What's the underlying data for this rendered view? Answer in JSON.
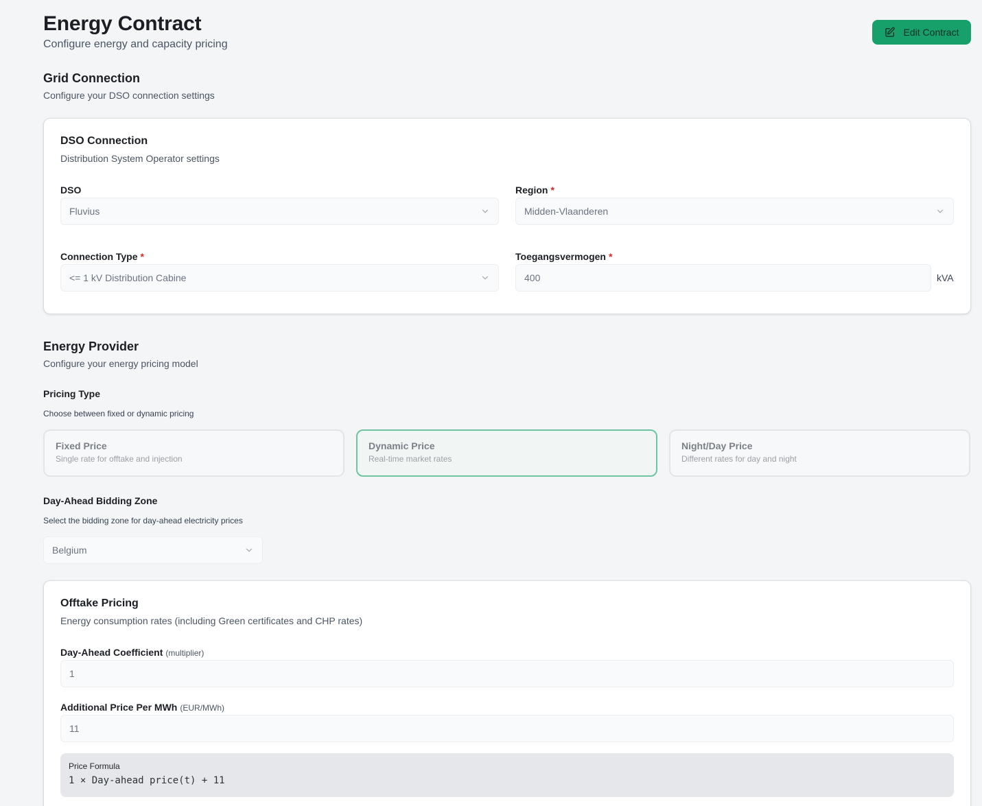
{
  "header": {
    "title": "Energy Contract",
    "subtitle": "Configure energy and capacity pricing",
    "edit_button": "Edit Contract"
  },
  "grid_connection": {
    "title": "Grid Connection",
    "subtitle": "Configure your DSO connection settings",
    "card": {
      "title": "DSO Connection",
      "subtitle": "Distribution System Operator settings",
      "dso": {
        "label": "DSO",
        "value": "Fluvius"
      },
      "region": {
        "label": "Region",
        "value": "Midden-Vlaanderen",
        "required": "*"
      },
      "connection_type": {
        "label": "Connection Type",
        "value": "<= 1 kV Distribution Cabine",
        "required": "*"
      },
      "access_power": {
        "label": "Toegangsvermogen",
        "value": "400",
        "unit": "kVA",
        "required": "*"
      }
    }
  },
  "energy_provider": {
    "title": "Energy Provider",
    "subtitle": "Configure your energy pricing model",
    "pricing_type": {
      "label": "Pricing Type",
      "description": "Choose between fixed or dynamic pricing",
      "selected": "Dynamic Price",
      "options": [
        {
          "title": "Fixed Price",
          "description": "Single rate for offtake and injection"
        },
        {
          "title": "Dynamic Price",
          "description": "Real-time market rates"
        },
        {
          "title": "Night/Day Price",
          "description": "Different rates for day and night"
        }
      ]
    },
    "bidding_zone": {
      "label": "Day-Ahead Bidding Zone",
      "description": "Select the bidding zone for day-ahead electricity prices",
      "value": "Belgium"
    }
  },
  "offtake": {
    "title": "Offtake Pricing",
    "subtitle": "Energy consumption rates (including Green certificates and CHP rates)",
    "coefficient": {
      "label": "Day-Ahead Coefficient",
      "unit": "(multiplier)",
      "value": "1"
    },
    "additional_price": {
      "label": "Additional Price Per MWh",
      "unit": "(EUR/MWh)",
      "value": "11"
    },
    "formula": {
      "label": "Price Formula",
      "text": "1 × Day-ahead price(t) + 11"
    }
  },
  "colors": {
    "accent": "#18a06b",
    "required": "#dc2626",
    "selected_border": "#6fc3a1"
  },
  "icons": {
    "edit": "edit-square-icon",
    "dropdown": "chevron-down-icon"
  }
}
